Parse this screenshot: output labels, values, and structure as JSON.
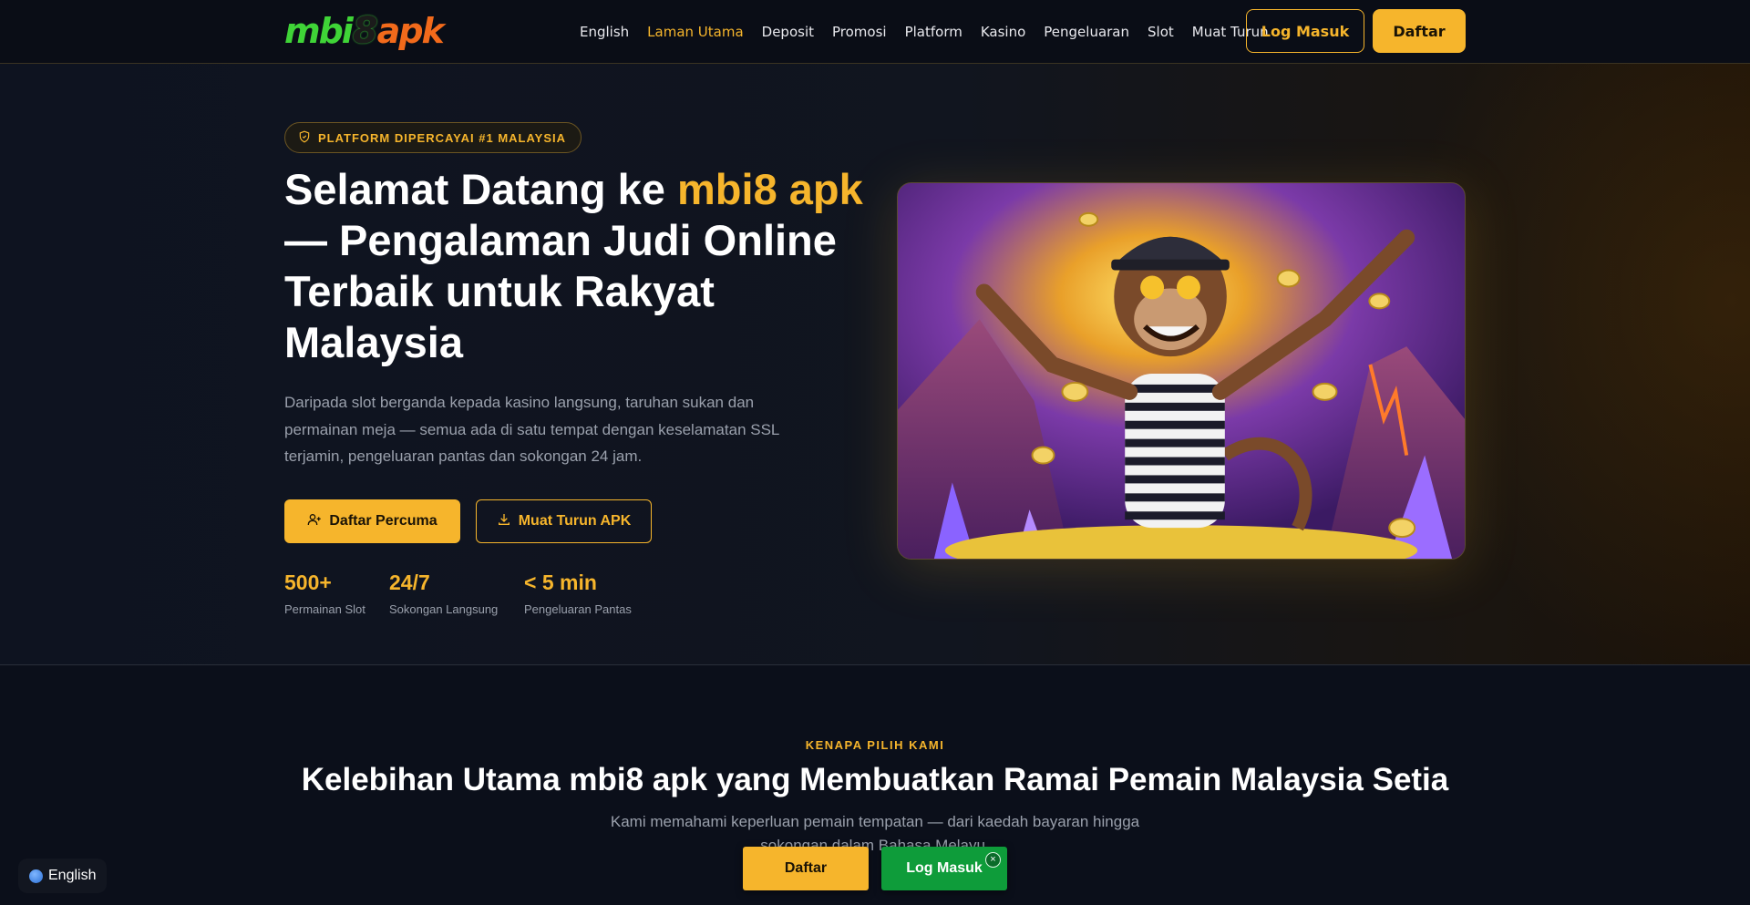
{
  "brand": {
    "logo_left": "mbi",
    "logo_mid": "8",
    "logo_right": "apk"
  },
  "nav": {
    "items": [
      {
        "label": "English",
        "active": false
      },
      {
        "label": "Laman Utama",
        "active": true
      },
      {
        "label": "Deposit",
        "active": false
      },
      {
        "label": "Promosi",
        "active": false
      },
      {
        "label": "Platform",
        "active": false
      },
      {
        "label": "Kasino",
        "active": false
      },
      {
        "label": "Pengeluaran",
        "active": false
      },
      {
        "label": "Slot",
        "active": false
      },
      {
        "label": "Muat Turun",
        "active": false
      }
    ],
    "login_label": "Log Masuk",
    "register_label": "Daftar"
  },
  "hero": {
    "badge_text": "PLATFORM DIPERCAYAI #1 MALAYSIA",
    "title_part1": "Selamat Datang ke ",
    "title_highlight": "mbi8 apk",
    "title_part2": " — Pengalaman Judi Online Terbaik untuk Rakyat Malaysia",
    "description": "Daripada slot berganda kepada kasino langsung, taruhan sukan dan permainan meja — semua ada di satu tempat dengan keselamatan SSL terjamin, pengeluaran pantas dan sokongan 24 jam.",
    "cta_primary": "Daftar Percuma",
    "cta_secondary": "Muat Turun APK",
    "stats": [
      {
        "value": "500+",
        "label": "Permainan Slot"
      },
      {
        "value": "24/7",
        "label": "Sokongan Langsung"
      },
      {
        "value": "< 5 min",
        "label": "Pengeluaran Pantas"
      }
    ]
  },
  "features": {
    "eyebrow": "KENAPA PILIH KAMI",
    "title": "Kelebihan Utama mbi8 apk yang Membuatkan Ramai Pemain Malaysia Setia",
    "description": "Kami memahami keperluan pemain tempatan — dari kaedah bayaran hingga sokongan dalam Bahasa Melayu."
  },
  "floating": {
    "language_label": "English",
    "register_label": "Daftar",
    "login_label": "Log Masuk",
    "close_symbol": "×"
  },
  "colors": {
    "accent": "#f6b52c",
    "background": "#0b0f1a",
    "login_green": "#0e9c3a",
    "muted_text": "#9aa0ac"
  }
}
